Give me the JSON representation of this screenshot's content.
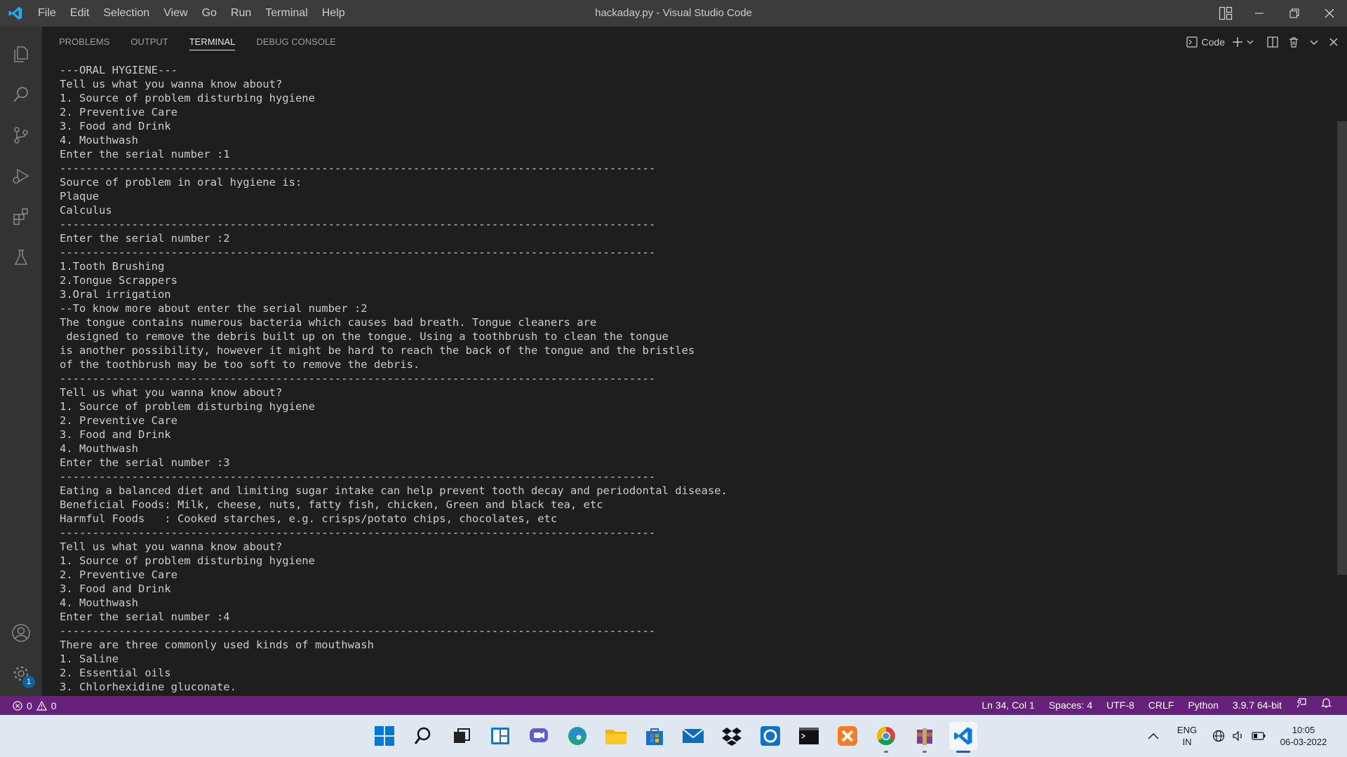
{
  "window": {
    "title": "hackaday.py - Visual Studio Code"
  },
  "menu": [
    "File",
    "Edit",
    "Selection",
    "View",
    "Go",
    "Run",
    "Terminal",
    "Help"
  ],
  "panel": {
    "tabs": [
      "PROBLEMS",
      "OUTPUT",
      "TERMINAL",
      "DEBUG CONSOLE"
    ],
    "active_tab": "TERMINAL",
    "terminal_profile": "Code"
  },
  "activity_badge": "1",
  "terminal_lines": [
    "---ORAL HYGIENE---",
    "Tell us what you wanna know about?",
    "1. Source of problem disturbing hygiene",
    "2. Preventive Care",
    "3. Food and Drink",
    "4. Mouthwash",
    "Enter the serial number :1",
    "-------------------------------------------------------------------------------------------",
    "Source of problem in oral hygiene is:",
    "Plaque",
    "Calculus",
    "-------------------------------------------------------------------------------------------",
    "Enter the serial number :2",
    "-------------------------------------------------------------------------------------------",
    "1.Tooth Brushing",
    "2.Tongue Scrappers",
    "3.Oral irrigation",
    "--To know more about enter the serial number :2",
    "The tongue contains numerous bacteria which causes bad breath. Tongue cleaners are",
    " designed to remove the debris built up on the tongue. Using a toothbrush to clean the tongue",
    "is another possibility, however it might be hard to reach the back of the tongue and the bristles",
    "of the toothbrush may be too soft to remove the debris.",
    "-------------------------------------------------------------------------------------------",
    "Tell us what you wanna know about?",
    "1. Source of problem disturbing hygiene",
    "2. Preventive Care",
    "3. Food and Drink",
    "4. Mouthwash",
    "Enter the serial number :3",
    "-------------------------------------------------------------------------------------------",
    "Eating a balanced diet and limiting sugar intake can help prevent tooth decay and periodontal disease.",
    "Beneficial Foods: Milk, cheese, nuts, fatty fish, chicken, Green and black tea, etc",
    "Harmful Foods   : Cooked starches, e.g. crisps/potato chips, chocolates, etc",
    "-------------------------------------------------------------------------------------------",
    "Tell us what you wanna know about?",
    "1. Source of problem disturbing hygiene",
    "2. Preventive Care",
    "3. Food and Drink",
    "4. Mouthwash",
    "Enter the serial number :4",
    "-------------------------------------------------------------------------------------------",
    "There are three commonly used kinds of mouthwash",
    "1. Saline",
    "2. Essential oils",
    "3. Chlorhexidine gluconate."
  ],
  "status": {
    "errors": "0",
    "warnings": "0",
    "position": "Ln 34, Col 1",
    "spaces": "Spaces: 4",
    "encoding": "UTF-8",
    "eol": "CRLF",
    "language": "Python",
    "interpreter": "3.9.7 64-bit"
  },
  "tray": {
    "lang1": "ENG",
    "lang2": "IN",
    "time": "10:05",
    "date": "06-03-2022"
  },
  "colors": {
    "statusbar": "#68217a",
    "titlebar": "#3c3c3c",
    "activitybar": "#333333",
    "editor_bg": "#1e1e1e",
    "taskbar": "#dfe7f0",
    "accent": "#0067c0"
  }
}
